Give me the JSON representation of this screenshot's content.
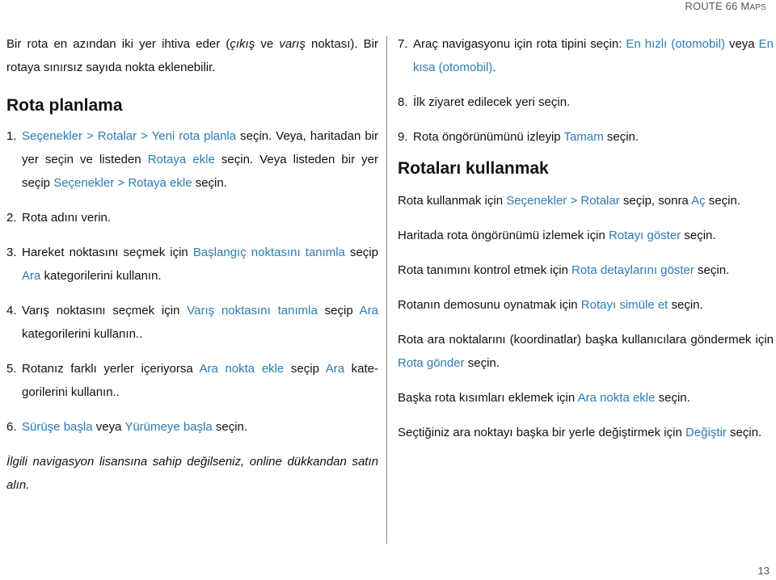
{
  "header": {
    "title_main": "ROUTE 66 M",
    "title_sc": "APS"
  },
  "left": {
    "intro": {
      "p1": "Bir rota en azından iki yer ihtiva eder (",
      "em1": "çıkış",
      "p2": " ve ",
      "em2": "varış",
      "p3": " noktası). Bir rotaya sınırsız sayıda nokta eklenebilir."
    },
    "heading": "Rota planlama",
    "steps": [
      {
        "num": "1.",
        "parts": [
          {
            "t": "Seçenekler > Rotalar > Yeni rota planla",
            "link": true
          },
          {
            "t": " seçin. Veya, harita­dan bir yer seçin ve listeden ",
            "link": false
          },
          {
            "t": "Rotaya ekle",
            "link": true
          },
          {
            "t": " seçin. Veya listeden bir yer seçip ",
            "link": false
          },
          {
            "t": "Seçenekler > Rotaya ekle",
            "link": true
          },
          {
            "t": " seçin.",
            "link": false
          }
        ]
      },
      {
        "num": "2.",
        "parts": [
          {
            "t": "Rota adını verin.",
            "link": false
          }
        ]
      },
      {
        "num": "3.",
        "parts": [
          {
            "t": "Hareket noktasını seçmek için ",
            "link": false
          },
          {
            "t": "Başlangıç noktasını tanımla",
            "link": true
          },
          {
            "t": " seçip ",
            "link": false
          },
          {
            "t": "Ara",
            "link": true
          },
          {
            "t": " kategorilerini kullanın.",
            "link": false
          }
        ]
      },
      {
        "num": "4.",
        "parts": [
          {
            "t": "Varış noktasını seçmek için ",
            "link": false
          },
          {
            "t": "Varış noktasını tanımla",
            "link": true
          },
          {
            "t": " seçip ",
            "link": false
          },
          {
            "t": "Ara",
            "link": true
          },
          {
            "t": " kategorilerini kullanın..",
            "link": false
          }
        ]
      },
      {
        "num": "5.",
        "parts": [
          {
            "t": "Rotanız farklı yerler içeriyorsa ",
            "link": false
          },
          {
            "t": "Ara nokta ekle",
            "link": true
          },
          {
            "t": " seçip ",
            "link": false
          },
          {
            "t": "Ara",
            "link": true
          },
          {
            "t": " kate­gorilerini kullanın..",
            "link": false
          }
        ]
      },
      {
        "num": "6.",
        "parts": [
          {
            "t": "Sürüşe başla",
            "link": true
          },
          {
            "t": " veya ",
            "link": false
          },
          {
            "t": "Yürümeye başla",
            "link": true
          },
          {
            "t": " seçin.",
            "link": false
          }
        ]
      }
    ],
    "note": "İlgili navigasyon lisansına sahip değilseniz, online dükkandan satın alın."
  },
  "right": {
    "steps": [
      {
        "num": "7.",
        "parts": [
          {
            "t": "Araç navigasyonu için rota tipini seçin: ",
            "link": false
          },
          {
            "t": "En hızlı (otomobil)",
            "link": true
          },
          {
            "t": " veya ",
            "link": false
          },
          {
            "t": "En kısa (otomobil)",
            "link": true
          },
          {
            "t": ".",
            "link": false
          }
        ]
      },
      {
        "num": "8.",
        "parts": [
          {
            "t": "İlk ziyaret edilecek yeri seçin.",
            "link": false
          }
        ]
      },
      {
        "num": "9.",
        "parts": [
          {
            "t": "Rota öngörünümünü izleyip ",
            "link": false
          },
          {
            "t": "Tamam",
            "link": true
          },
          {
            "t": " seçin.",
            "link": false
          }
        ]
      }
    ],
    "heading": "Rotaları kullanmak",
    "paras": [
      {
        "parts": [
          {
            "t": "Rota kullanmak için ",
            "link": false
          },
          {
            "t": "Seçenekler > Rotalar",
            "link": true
          },
          {
            "t": " seçip, sonra ",
            "link": false
          },
          {
            "t": "Aç",
            "link": true
          },
          {
            "t": " seçin.",
            "link": false
          }
        ]
      },
      {
        "parts": [
          {
            "t": "Haritada rota öngörünümü izlemek için ",
            "link": false
          },
          {
            "t": "Rotayı göster",
            "link": true
          },
          {
            "t": " seçin.",
            "link": false
          }
        ]
      },
      {
        "parts": [
          {
            "t": "Rota tanımını kontrol etmek için ",
            "link": false
          },
          {
            "t": "Rota detaylarını göster",
            "link": true
          },
          {
            "t": " seçin.",
            "link": false
          }
        ]
      },
      {
        "parts": [
          {
            "t": "Rotanın demosunu oynatmak için ",
            "link": false
          },
          {
            "t": "Rotayı simüle et",
            "link": true
          },
          {
            "t": " seçin.",
            "link": false
          }
        ]
      },
      {
        "parts": [
          {
            "t": "Rota ara noktalarını (koordinatlar) başka kullanıcılara göndermek için ",
            "link": false
          },
          {
            "t": "Rota gönder",
            "link": true
          },
          {
            "t": " seçin.",
            "link": false
          }
        ]
      },
      {
        "parts": [
          {
            "t": "Başka rota kısımları eklemek için ",
            "link": false
          },
          {
            "t": "Ara nokta ekle",
            "link": true
          },
          {
            "t": " seçin.",
            "link": false
          }
        ]
      },
      {
        "parts": [
          {
            "t": "Seçtiğiniz ara noktayı başka bir yerle değiştirmek için ",
            "link": false
          },
          {
            "t": "Değiştir",
            "link": true
          },
          {
            "t": " seçin.",
            "link": false
          }
        ]
      }
    ]
  },
  "footer": {
    "page_number": "13"
  },
  "colors": {
    "link": "#2b7bb4",
    "text": "#111111",
    "muted": "#555555"
  }
}
